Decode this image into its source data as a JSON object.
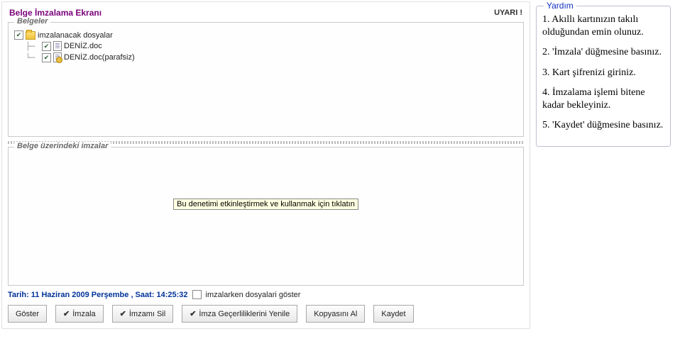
{
  "header": {
    "title": "Belge İmzalama Ekranı",
    "warning": "UYARI !"
  },
  "documents": {
    "legend": "Belgeler",
    "root": {
      "label": "imzalanacak dosyalar",
      "checked": true
    },
    "items": [
      {
        "label": "DENİZ.doc",
        "checked": true
      },
      {
        "label": "DENİZ.doc(parafsiz)",
        "checked": true
      }
    ]
  },
  "signatures": {
    "legend": "Belge üzerindeki imzalar",
    "tooltip": "Bu denetimi etkinleştirmek ve kullanmak için tıklatın"
  },
  "status": {
    "datetime": "Tarih: 11 Haziran 2009 Perşembe , Saat: 14:25:32",
    "showFilesLabel": "imzalarken dosyalari göster",
    "showFilesChecked": false
  },
  "buttons": {
    "show": "Göster",
    "sign": "İmzala",
    "deleteSig": "İmzamı Sil",
    "refresh": "İmza Geçerliliklerini Yenile",
    "copy": "Kopyasını Al",
    "save": "Kaydet"
  },
  "help": {
    "title": "Yardım",
    "steps": [
      "1. Akıllı kartınızın takılı olduğundan emin olunuz.",
      "2. 'İmzala' düğmesine basınız.",
      "3. Kart şifrenizi giriniz.",
      "4. İmzalama işlemi bitene kadar bekleyiniz.",
      "5. 'Kaydet' düğmesine basınız."
    ]
  }
}
